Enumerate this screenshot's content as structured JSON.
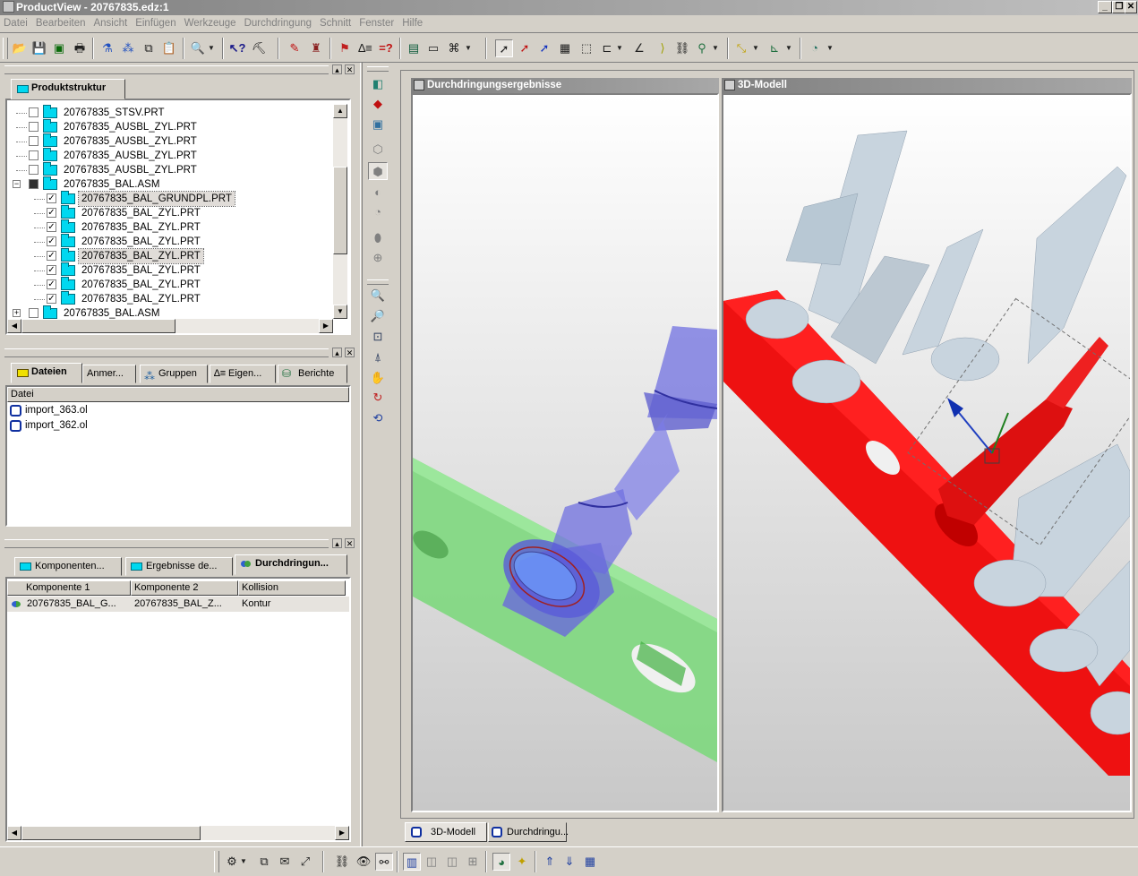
{
  "window": {
    "title": "ProductView - 20767835.edz:1",
    "controls": [
      "_",
      "❐",
      "✕"
    ]
  },
  "menu": [
    "Datei",
    "Bearbeiten",
    "Ansicht",
    "Einfügen",
    "Werkzeuge",
    "Durchdringung",
    "Schnitt",
    "Fenster",
    "Hilfe"
  ],
  "toolbar_icons": [
    "open-icon",
    "save-icon",
    "save-all-icon",
    "print-icon",
    "filter-icon",
    "hierarchy-icon",
    "copy-icon",
    "paste-icon",
    "find-icon",
    "context-help-icon",
    "whats-this-icon",
    "markup-pen-icon",
    "stamp-icon",
    "measure-icon",
    "interference-icon",
    "query-icon",
    "view-icon",
    "properties-icon",
    "binoculars-icon",
    "select-icon",
    "select-add-icon",
    "select-remove-icon",
    "ruler-icon",
    "box-select-icon",
    "bounds-icon",
    "angle-icon",
    "arc-icon",
    "snap-icon",
    "pin-icon",
    "axis-icon",
    "section-icon",
    "render-icon"
  ],
  "produktstruktur": {
    "tab": "Produktstruktur",
    "items": [
      {
        "label": "20767835_STSV.PRT",
        "level": 1,
        "checked": false,
        "selected": false
      },
      {
        "label": "20767835_AUSBL_ZYL.PRT",
        "level": 1,
        "checked": false,
        "selected": false
      },
      {
        "label": "20767835_AUSBL_ZYL.PRT",
        "level": 1,
        "checked": false,
        "selected": false
      },
      {
        "label": "20767835_AUSBL_ZYL.PRT",
        "level": 1,
        "checked": false,
        "selected": false
      },
      {
        "label": "20767835_AUSBL_ZYL.PRT",
        "level": 1,
        "checked": false,
        "selected": false
      },
      {
        "label": "20767835_BAL.ASM",
        "level": 1,
        "checked": "partial",
        "selected": false,
        "expander": "−"
      },
      {
        "label": "20767835_BAL_GRUNDPL.PRT",
        "level": 2,
        "checked": true,
        "selected": true
      },
      {
        "label": "20767835_BAL_ZYL.PRT",
        "level": 2,
        "checked": true,
        "selected": false
      },
      {
        "label": "20767835_BAL_ZYL.PRT",
        "level": 2,
        "checked": true,
        "selected": false
      },
      {
        "label": "20767835_BAL_ZYL.PRT",
        "level": 2,
        "checked": true,
        "selected": false
      },
      {
        "label": "20767835_BAL_ZYL.PRT",
        "level": 2,
        "checked": true,
        "selected": true
      },
      {
        "label": "20767835_BAL_ZYL.PRT",
        "level": 2,
        "checked": true,
        "selected": false
      },
      {
        "label": "20767835_BAL_ZYL.PRT",
        "level": 2,
        "checked": true,
        "selected": false
      },
      {
        "label": "20767835_BAL_ZYL.PRT",
        "level": 2,
        "checked": true,
        "selected": false
      },
      {
        "label": "20767835_BAL.ASM",
        "level": 1,
        "checked": false,
        "selected": false,
        "expander": "+"
      }
    ]
  },
  "dateien": {
    "tabs": [
      "Dateien",
      "Anmer...",
      "Gruppen",
      "Eigen...",
      "Berichte"
    ],
    "column": "Datei",
    "files": [
      "import_363.ol",
      "import_362.ol"
    ]
  },
  "durchdringung": {
    "tabs": [
      "Komponenten...",
      "Ergebnisse de...",
      "Durchdringun..."
    ],
    "columns": [
      "Komponente 1",
      "Komponente 2",
      "Kollision"
    ],
    "rows": [
      [
        "20767835_BAL_G...",
        "20767835_BAL_Z...",
        "Kontur"
      ]
    ]
  },
  "viewports": {
    "left_title": "Durchdringungsergebnisse",
    "right_title": "3D-Modell",
    "bottom_tabs": [
      "3D-Modell",
      "Durchdringu..."
    ]
  },
  "colors": {
    "accent_red": "#ee1111",
    "part_green": "#7ed87e",
    "part_blue": "#7070e0",
    "part_grey": "#c8d4de"
  }
}
